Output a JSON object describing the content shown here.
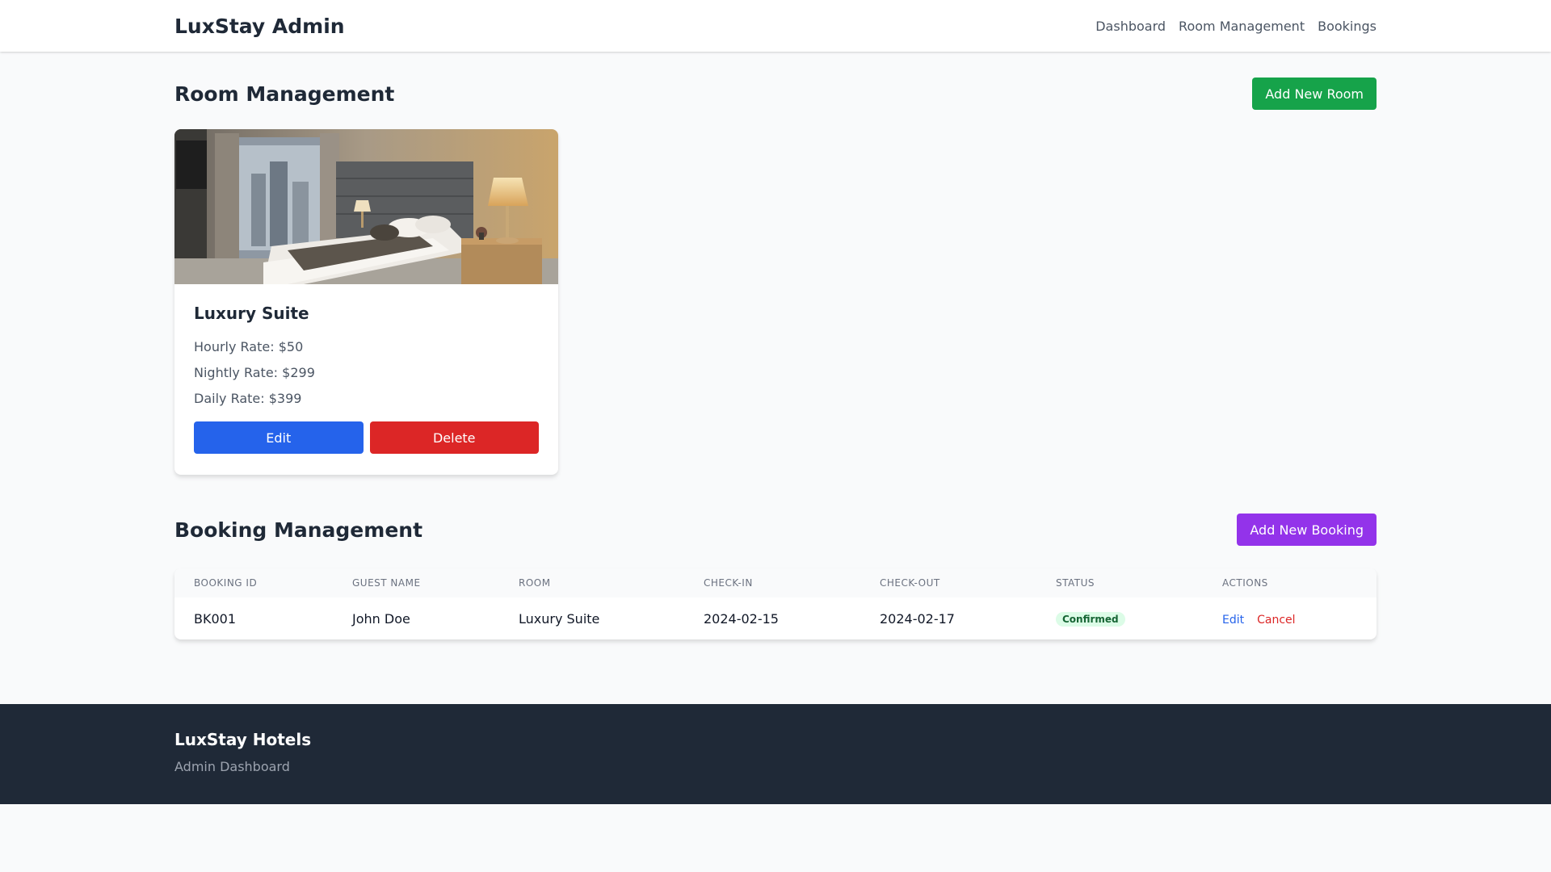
{
  "nav": {
    "brand": "LuxStay Admin",
    "links": [
      "Dashboard",
      "Room Management",
      "Bookings"
    ]
  },
  "rooms_section": {
    "title": "Room Management",
    "add_button": "Add New Room",
    "rooms": [
      {
        "name": "Luxury Suite",
        "hourly_rate": "Hourly Rate: $50",
        "nightly_rate": "Nightly Rate: $299",
        "daily_rate": "Daily Rate: $399",
        "edit_label": "Edit",
        "delete_label": "Delete"
      }
    ]
  },
  "bookings_section": {
    "title": "Booking Management",
    "add_button": "Add New Booking",
    "columns": [
      "BOOKING ID",
      "GUEST NAME",
      "ROOM",
      "CHECK-IN",
      "CHECK-OUT",
      "STATUS",
      "ACTIONS"
    ],
    "rows": [
      {
        "booking_id": "BK001",
        "guest_name": "John Doe",
        "room": "Luxury Suite",
        "check_in": "2024-02-15",
        "check_out": "2024-02-17",
        "status": "Confirmed",
        "edit_label": "Edit",
        "cancel_label": "Cancel"
      }
    ]
  },
  "footer": {
    "title": "LuxStay Hotels",
    "subtitle": "Admin Dashboard"
  },
  "colors": {
    "primary_blue": "#2563eb",
    "danger_red": "#dc2626",
    "success_green": "#16a34a",
    "accent_purple": "#9333ea",
    "footer_bg": "#1f2937"
  }
}
